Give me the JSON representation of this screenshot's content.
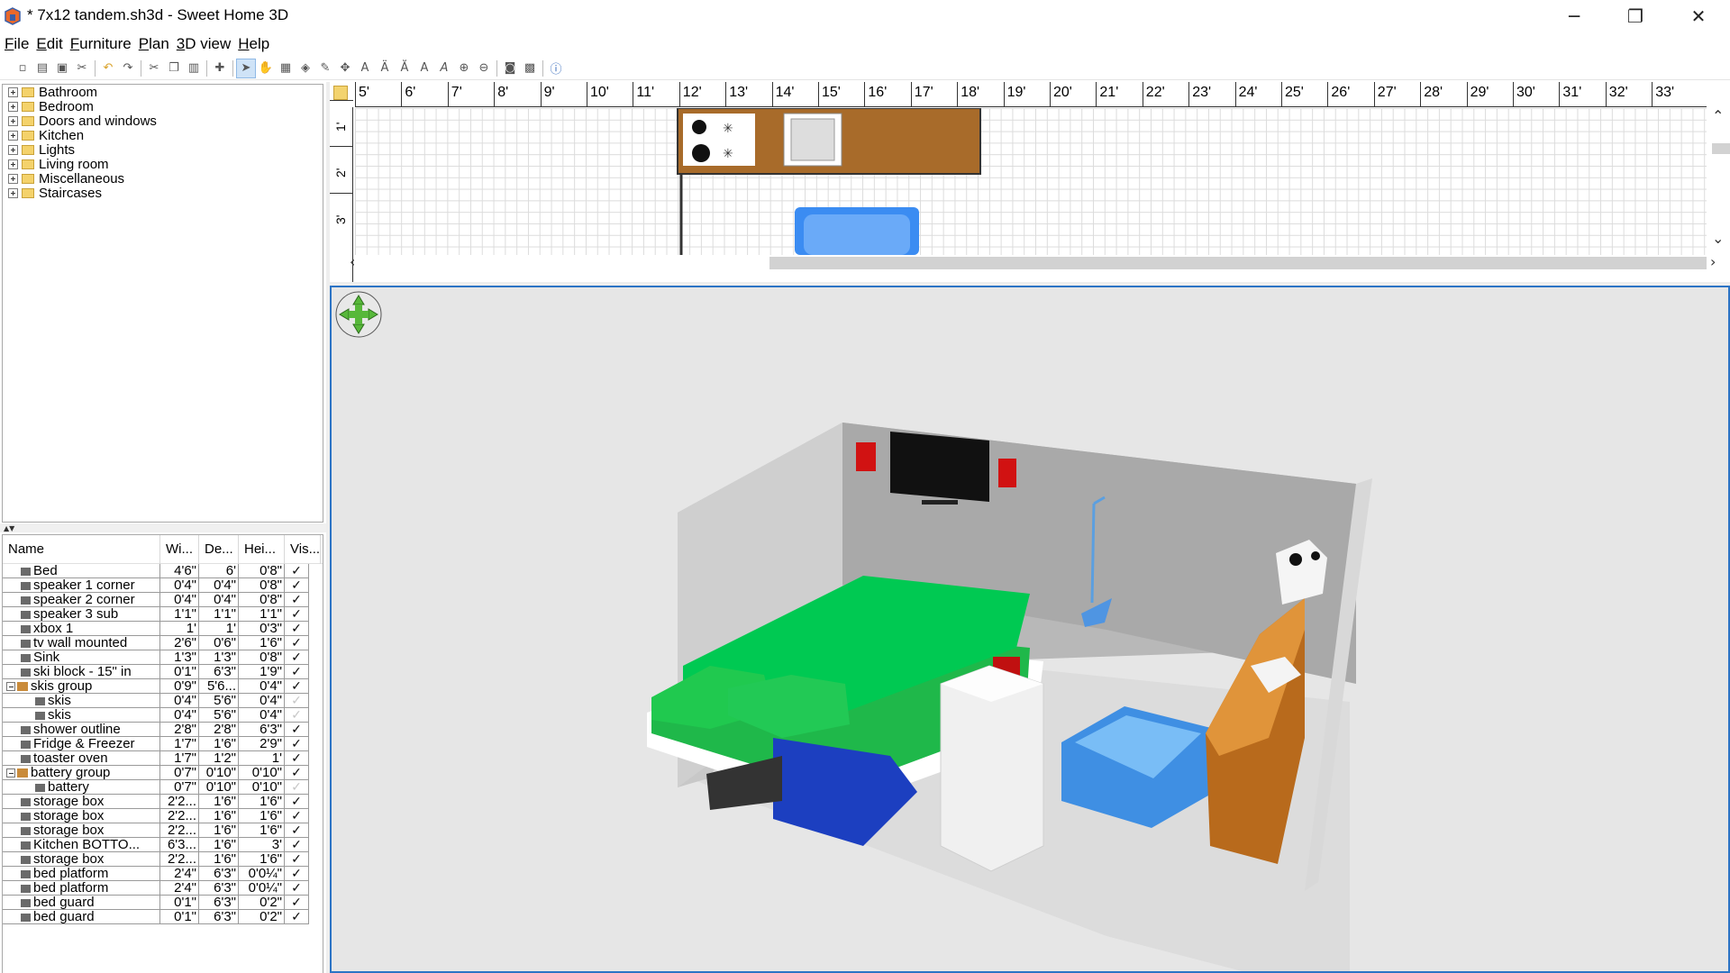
{
  "window": {
    "title": "* 7x12 tandem.sh3d - Sweet Home 3D",
    "minimize": "─",
    "restore": "❐",
    "close": "✕"
  },
  "menu": [
    {
      "label": "File",
      "u": "F",
      "rest": "ile"
    },
    {
      "label": "Edit",
      "u": "E",
      "rest": "dit"
    },
    {
      "label": "Furniture",
      "u": "F",
      "rest": "urniture"
    },
    {
      "label": "Plan",
      "u": "P",
      "rest": "lan"
    },
    {
      "label": "3D view",
      "u": "3",
      "rest": "D view"
    },
    {
      "label": "Help",
      "u": "H",
      "rest": "elp"
    }
  ],
  "catalog": [
    "Bathroom",
    "Bedroom",
    "Doors and windows",
    "Kitchen",
    "Lights",
    "Living room",
    "Miscellaneous",
    "Staircases"
  ],
  "furniture_headers": {
    "name": "Name",
    "w": "Wi...",
    "d": "De...",
    "h": "Hei...",
    "v": "Vis..."
  },
  "furniture": [
    {
      "name": "Bed",
      "w": "4'6\"",
      "d": "6'",
      "h": "0'8\"",
      "visible": true,
      "indent": 1
    },
    {
      "name": "speaker 1 corner",
      "w": "0'4\"",
      "d": "0'4\"",
      "h": "0'8\"",
      "visible": true,
      "indent": 1
    },
    {
      "name": "speaker 2 corner",
      "w": "0'4\"",
      "d": "0'4\"",
      "h": "0'8\"",
      "visible": true,
      "indent": 1
    },
    {
      "name": "speaker 3 sub",
      "w": "1'1\"",
      "d": "1'1\"",
      "h": "1'1\"",
      "visible": true,
      "indent": 1
    },
    {
      "name": "xbox 1",
      "w": "1'",
      "d": "1'",
      "h": "0'3\"",
      "visible": true,
      "indent": 1
    },
    {
      "name": "tv wall mounted",
      "w": "2'6\"",
      "d": "0'6\"",
      "h": "1'6\"",
      "visible": true,
      "indent": 1
    },
    {
      "name": "Sink",
      "w": "1'3\"",
      "d": "1'3\"",
      "h": "0'8\"",
      "visible": true,
      "indent": 1
    },
    {
      "name": "ski block - 15\" in",
      "w": "0'1\"",
      "d": "6'3\"",
      "h": "1'9\"",
      "visible": true,
      "indent": 1
    },
    {
      "name": "skis group",
      "w": "0'9\"",
      "d": "5'6...",
      "h": "0'4\"",
      "visible": true,
      "group": true
    },
    {
      "name": "skis",
      "w": "0'4\"",
      "d": "5'6\"",
      "h": "0'4\"",
      "visible": false,
      "indent": 2
    },
    {
      "name": "skis",
      "w": "0'4\"",
      "d": "5'6\"",
      "h": "0'4\"",
      "visible": false,
      "indent": 2
    },
    {
      "name": "shower outline",
      "w": "2'8\"",
      "d": "2'8\"",
      "h": "6'3\"",
      "visible": true,
      "indent": 1
    },
    {
      "name": "Fridge & Freezer",
      "w": "1'7\"",
      "d": "1'6\"",
      "h": "2'9\"",
      "visible": true,
      "indent": 1
    },
    {
      "name": "toaster oven",
      "w": "1'7\"",
      "d": "1'2\"",
      "h": "1'",
      "visible": true,
      "indent": 1
    },
    {
      "name": "battery group",
      "w": "0'7\"",
      "d": "0'10\"",
      "h": "0'10\"",
      "visible": true,
      "group": true
    },
    {
      "name": "battery",
      "w": "0'7\"",
      "d": "0'10\"",
      "h": "0'10\"",
      "visible": false,
      "indent": 2
    },
    {
      "name": "storage box",
      "w": "2'2...",
      "d": "1'6\"",
      "h": "1'6\"",
      "visible": true,
      "indent": 1
    },
    {
      "name": "storage box",
      "w": "2'2...",
      "d": "1'6\"",
      "h": "1'6\"",
      "visible": true,
      "indent": 1
    },
    {
      "name": "storage box",
      "w": "2'2...",
      "d": "1'6\"",
      "h": "1'6\"",
      "visible": true,
      "indent": 1
    },
    {
      "name": "Kitchen BOTTO...",
      "w": "6'3...",
      "d": "1'6\"",
      "h": "3'",
      "visible": true,
      "indent": 1
    },
    {
      "name": "storage box",
      "w": "2'2...",
      "d": "1'6\"",
      "h": "1'6\"",
      "visible": true,
      "indent": 1
    },
    {
      "name": "bed platform",
      "w": "2'4\"",
      "d": "6'3\"",
      "h": "0'0¼\"",
      "visible": true,
      "indent": 1
    },
    {
      "name": "bed platform",
      "w": "2'4\"",
      "d": "6'3\"",
      "h": "0'0¼\"",
      "visible": true,
      "indent": 1
    },
    {
      "name": "bed guard",
      "w": "0'1\"",
      "d": "6'3\"",
      "h": "0'2\"",
      "visible": true,
      "indent": 1
    },
    {
      "name": "bed guard",
      "w": "0'1\"",
      "d": "6'3\"",
      "h": "0'2\"",
      "visible": true,
      "indent": 1
    }
  ],
  "plan": {
    "ruler_top": [
      "5'",
      "6'",
      "7'",
      "8'",
      "9'",
      "10'",
      "11'",
      "12'",
      "13'",
      "14'",
      "15'",
      "16'",
      "17'",
      "18'",
      "19'",
      "20'",
      "21'",
      "22'",
      "23'",
      "24'",
      "25'",
      "26'",
      "27'",
      "28'",
      "29'",
      "30'",
      "31'",
      "32'",
      "33'"
    ],
    "ruler_left": [
      "1'",
      "2'",
      "3'"
    ]
  },
  "icons": {
    "toolbar": [
      "new-icon",
      "open-icon",
      "save-icon",
      "cut-prefs-icon",
      "undo-icon",
      "redo-icon",
      "cut-icon",
      "copy-icon",
      "paste-icon",
      "add-furniture-icon",
      "select-icon",
      "pan-icon",
      "create-walls-icon",
      "create-rooms-icon",
      "create-polylines-icon",
      "create-dimensions-icon",
      "add-text-icon",
      "bold-icon",
      "italic-icon",
      "increase-text-icon",
      "decrease-text-icon",
      "zoom-in-icon",
      "zoom-out-icon",
      "create-photo-icon",
      "create-video-icon",
      "help-icon"
    ]
  }
}
